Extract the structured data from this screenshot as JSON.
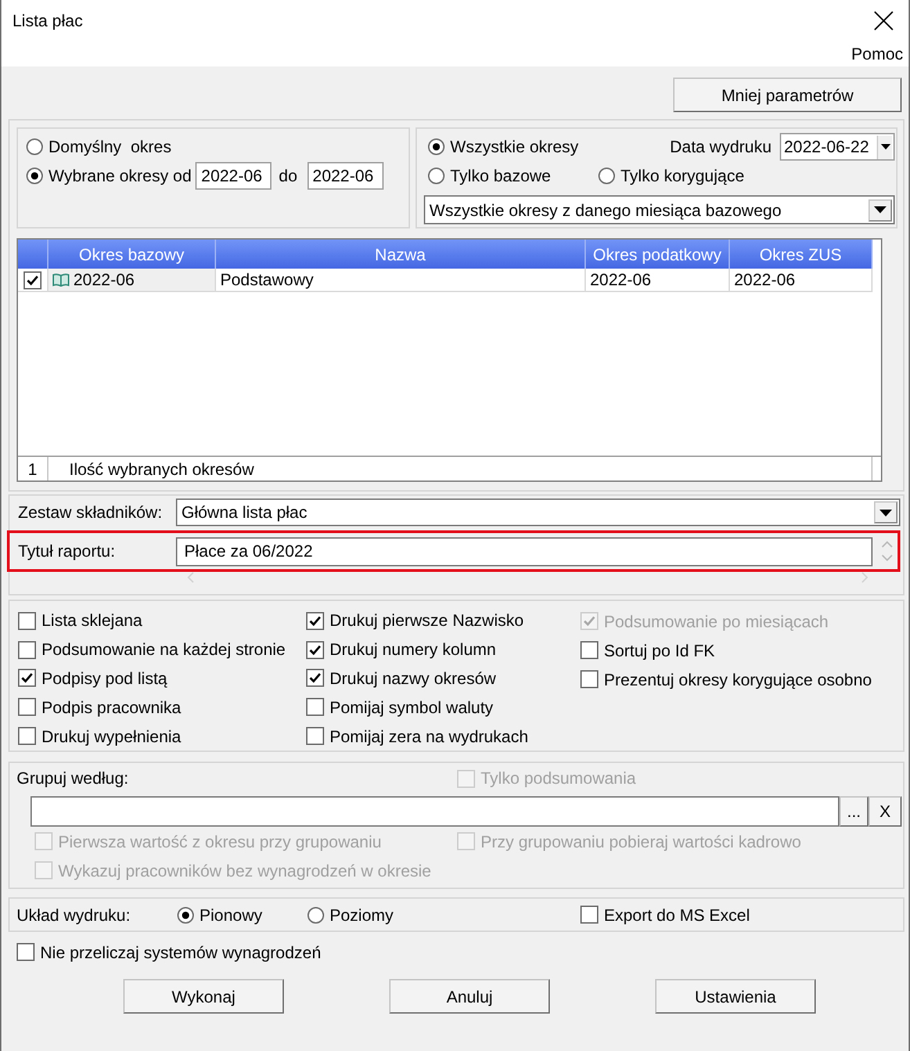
{
  "window": {
    "title": "Lista płac"
  },
  "menu": [
    {
      "label": "Pomoc"
    }
  ],
  "top_button": "Mniej parametrów",
  "period": {
    "range_options": [
      {
        "label": "Domyślny  okres",
        "selected": false
      },
      {
        "label": "Wybrane okresy od",
        "selected": true
      }
    ],
    "from": "2022-06",
    "to_label": "do",
    "to": "2022-06",
    "type_options": [
      {
        "label": "Wszystkie okresy",
        "selected": true
      },
      {
        "label": "Tylko bazowe",
        "selected": false
      },
      {
        "label": "Tylko korygujące",
        "selected": false
      }
    ],
    "print_date": {
      "label": "Data wydruku",
      "value": "2022-06-22"
    },
    "scope": "Wszystkie okresy z danego miesiąca bazowego"
  },
  "table": {
    "columns": [
      "Okres bazowy",
      "Nazwa",
      "Okres podatkowy",
      "Okres ZUS"
    ],
    "rows": [
      {
        "checked": true,
        "cells": [
          "2022-06",
          "Podstawowy",
          "2022-06",
          "2022-06"
        ]
      }
    ],
    "footer": {
      "count": "1",
      "label": "Ilość wybranych okresów"
    }
  },
  "components": {
    "label": "Zestaw składników:",
    "value": "Główna lista płac"
  },
  "report_title": {
    "label": "Tytuł raportu:",
    "value": "Płace za 06/2022",
    "highlighted": true
  },
  "options": {
    "columns": [
      {
        "items": [
          {
            "label": "Lista sklejana",
            "checked": false,
            "disabled": false
          },
          {
            "label": "Podsumowanie na każdej stronie",
            "checked": false,
            "disabled": false
          },
          {
            "label": "Podpisy pod listą",
            "checked": true,
            "disabled": false
          },
          {
            "label": "Podpis pracownika",
            "checked": false,
            "disabled": false
          },
          {
            "label": "Drukuj wypełnienia",
            "checked": false,
            "disabled": false
          }
        ]
      },
      {
        "items": [
          {
            "label": "Drukuj pierwsze Nazwisko",
            "checked": true,
            "disabled": false
          },
          {
            "label": "Drukuj numery kolumn",
            "checked": true,
            "disabled": false
          },
          {
            "label": "Drukuj nazwy okresów",
            "checked": true,
            "disabled": false
          },
          {
            "label": "Pomijaj symbol waluty",
            "checked": false,
            "disabled": false
          },
          {
            "label": "Pomijaj zera na wydrukach",
            "checked": false,
            "disabled": false
          }
        ]
      },
      {
        "items": [
          {
            "label": "Podsumowanie po miesiącach",
            "checked": true,
            "disabled": true
          },
          {
            "label": "Sortuj po Id FK",
            "checked": false,
            "disabled": false
          },
          {
            "label": "Prezentuj okresy korygujące osobno",
            "checked": false,
            "disabled": false
          }
        ]
      }
    ]
  },
  "grouping": {
    "label": "Grupuj według:",
    "summary_only": {
      "label": "Tylko podsumowania",
      "checked": false,
      "disabled": true
    },
    "buttons": [
      "...",
      "X"
    ],
    "options": [
      {
        "label": "Pierwsza wartość z okresu przy grupowaniu",
        "checked": false,
        "disabled": true
      },
      {
        "label": "Przy grupowaniu pobieraj wartości kadrowo",
        "checked": false,
        "disabled": true
      },
      {
        "label": "Wykazuj pracowników bez wynagrodzeń w okresie",
        "checked": false,
        "disabled": true
      }
    ]
  },
  "layout": {
    "label": "Układ wydruku:",
    "orientations": [
      {
        "label": "Pionowy",
        "selected": true
      },
      {
        "label": "Poziomy",
        "selected": false
      }
    ],
    "export": {
      "label": "Export do MS Excel",
      "checked": false
    }
  },
  "recalc_option": {
    "label": "Nie przeliczaj systemów wynagrodzeń",
    "checked": false
  },
  "buttons": [
    "Wykonaj",
    "Anuluj",
    "Ustawienia"
  ]
}
